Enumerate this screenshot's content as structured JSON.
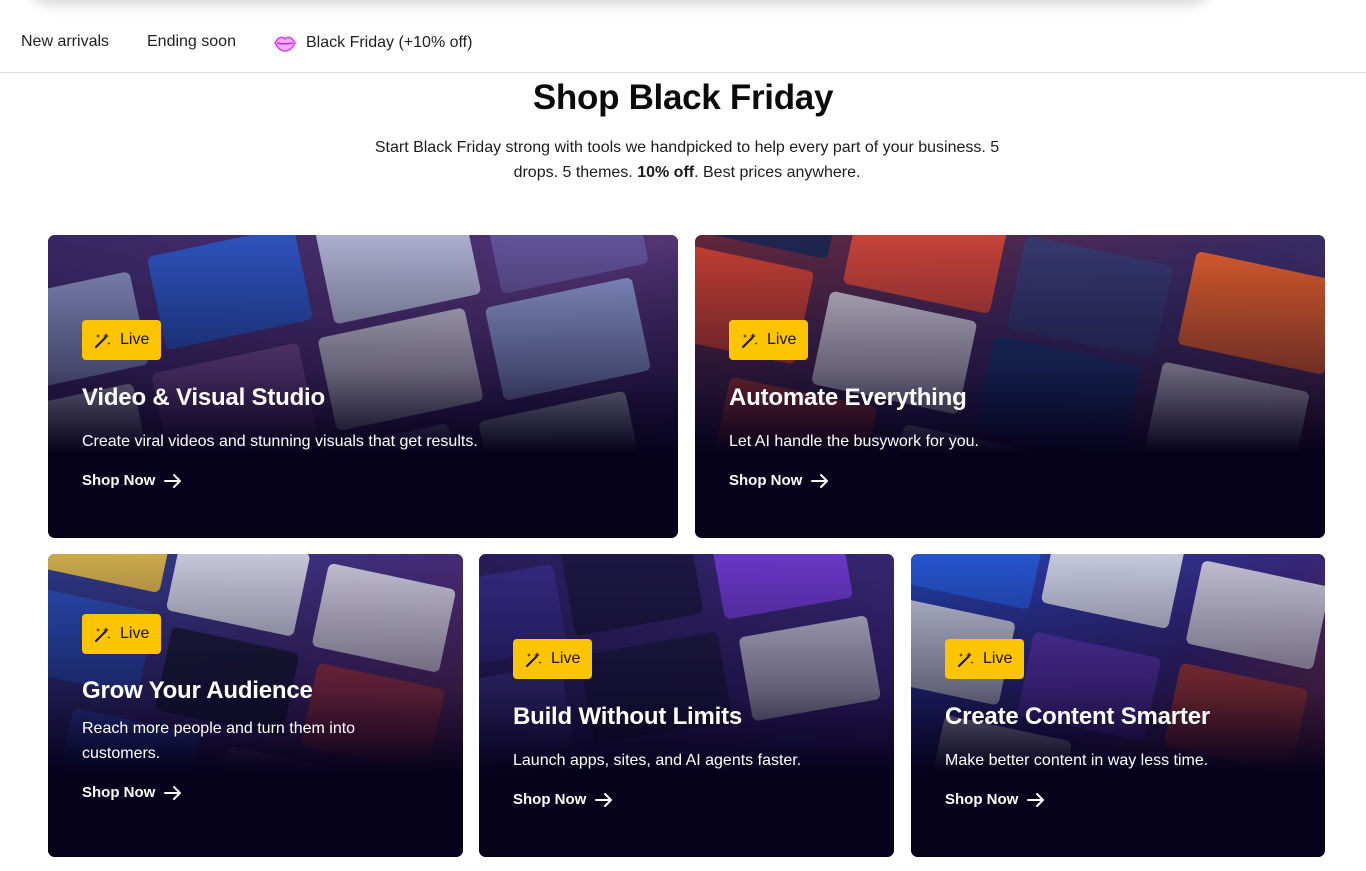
{
  "subnav": {
    "items": [
      {
        "label": "New arrivals"
      },
      {
        "label": "Ending soon"
      },
      {
        "label": "Black Friday (+10% off)",
        "icon": "lips-icon",
        "icon_color": "#e879f9"
      }
    ]
  },
  "hero": {
    "title": "Shop Black Friday",
    "subtitle_line1": "Start Black Friday strong with tools we handpicked to help every part of your business. 5",
    "subtitle_line2_pre": "drops. 5 themes. ",
    "subtitle_bold": "10% off",
    "subtitle_line2_post": ". Best prices anywhere."
  },
  "colors": {
    "badge": "#fcc500",
    "card_dark": "#06021c"
  },
  "cards": [
    {
      "badge": "Live",
      "badge_icon": "magic-wand-icon",
      "title": "Video & Visual Studio",
      "desc": "Create viral videos and stunning visuals that get results.",
      "cta": "Shop Now",
      "cta_icon": "arrow-right-icon"
    },
    {
      "badge": "Live",
      "badge_icon": "magic-wand-icon",
      "title": "Automate Everything",
      "desc": "Let AI handle the busywork for you.",
      "cta": "Shop Now",
      "cta_icon": "arrow-right-icon"
    },
    {
      "badge": "Live",
      "badge_icon": "magic-wand-icon",
      "title": "Grow Your Audience",
      "desc": "Reach more people and turn them into customers.",
      "cta": "Shop Now",
      "cta_icon": "arrow-right-icon"
    },
    {
      "badge": "Live",
      "badge_icon": "magic-wand-icon",
      "title": "Build Without Limits",
      "desc": "Launch apps, sites, and AI agents faster.",
      "cta": "Shop Now",
      "cta_icon": "arrow-right-icon"
    },
    {
      "badge": "Live",
      "badge_icon": "magic-wand-icon",
      "title": "Create Content Smarter",
      "desc": "Make better content in way less time.",
      "cta": "Shop Now",
      "cta_icon": "arrow-right-icon"
    }
  ]
}
